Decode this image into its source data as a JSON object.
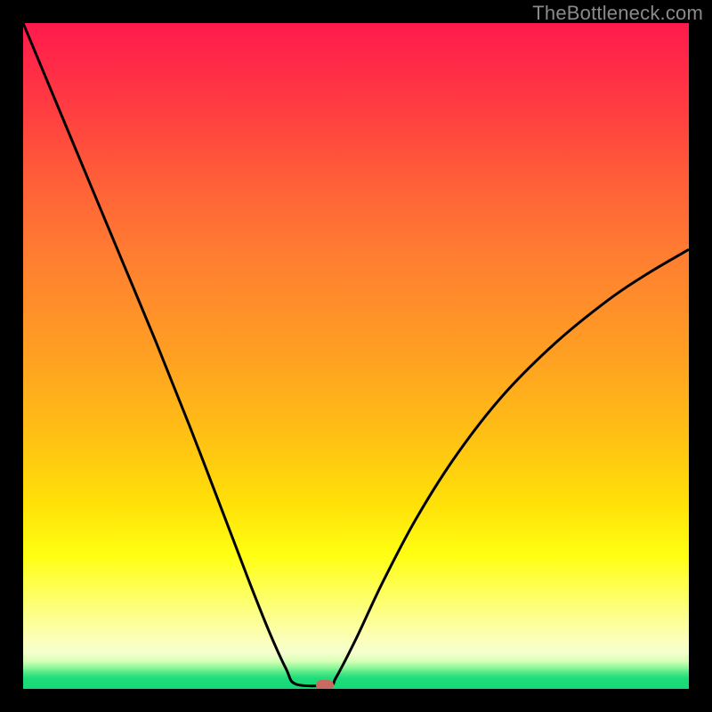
{
  "watermark": "TheBottleneck.com",
  "marker": {
    "x_frac": 0.453,
    "y_frac": 0.994,
    "color": "#c96a60"
  },
  "chart_data": {
    "type": "line",
    "title": "",
    "xlabel": "",
    "ylabel": "",
    "xlim": [
      0,
      1
    ],
    "ylim": [
      0,
      1
    ],
    "grid": false,
    "legend": false,
    "note": "Axes are unlabeled in the source image; values are normalized fractions of the plot area. y=1 is top (red / high bottleneck), y≈0 is bottom (green / no bottleneck). The curve dips to a flat minimum around x≈0.40–0.46 near y≈0.005, with a small marker at the minimum.",
    "series": [
      {
        "name": "bottleneck-curve",
        "x": [
          0.0,
          0.05,
          0.1,
          0.15,
          0.2,
          0.25,
          0.3,
          0.34,
          0.37,
          0.395,
          0.41,
          0.46,
          0.47,
          0.5,
          0.54,
          0.59,
          0.65,
          0.72,
          0.8,
          0.88,
          0.94,
          1.0
        ],
        "y": [
          1.0,
          0.88,
          0.76,
          0.64,
          0.52,
          0.395,
          0.265,
          0.16,
          0.085,
          0.03,
          0.007,
          0.006,
          0.017,
          0.075,
          0.16,
          0.255,
          0.35,
          0.44,
          0.52,
          0.585,
          0.625,
          0.66
        ]
      }
    ],
    "background_gradient_stops": [
      {
        "pos": 0.0,
        "color": "#ff1a4d"
      },
      {
        "pos": 0.5,
        "color": "#ffa022"
      },
      {
        "pos": 0.8,
        "color": "#ffff12"
      },
      {
        "pos": 0.95,
        "color": "#f6ffce"
      },
      {
        "pos": 1.0,
        "color": "#14d877"
      }
    ]
  }
}
